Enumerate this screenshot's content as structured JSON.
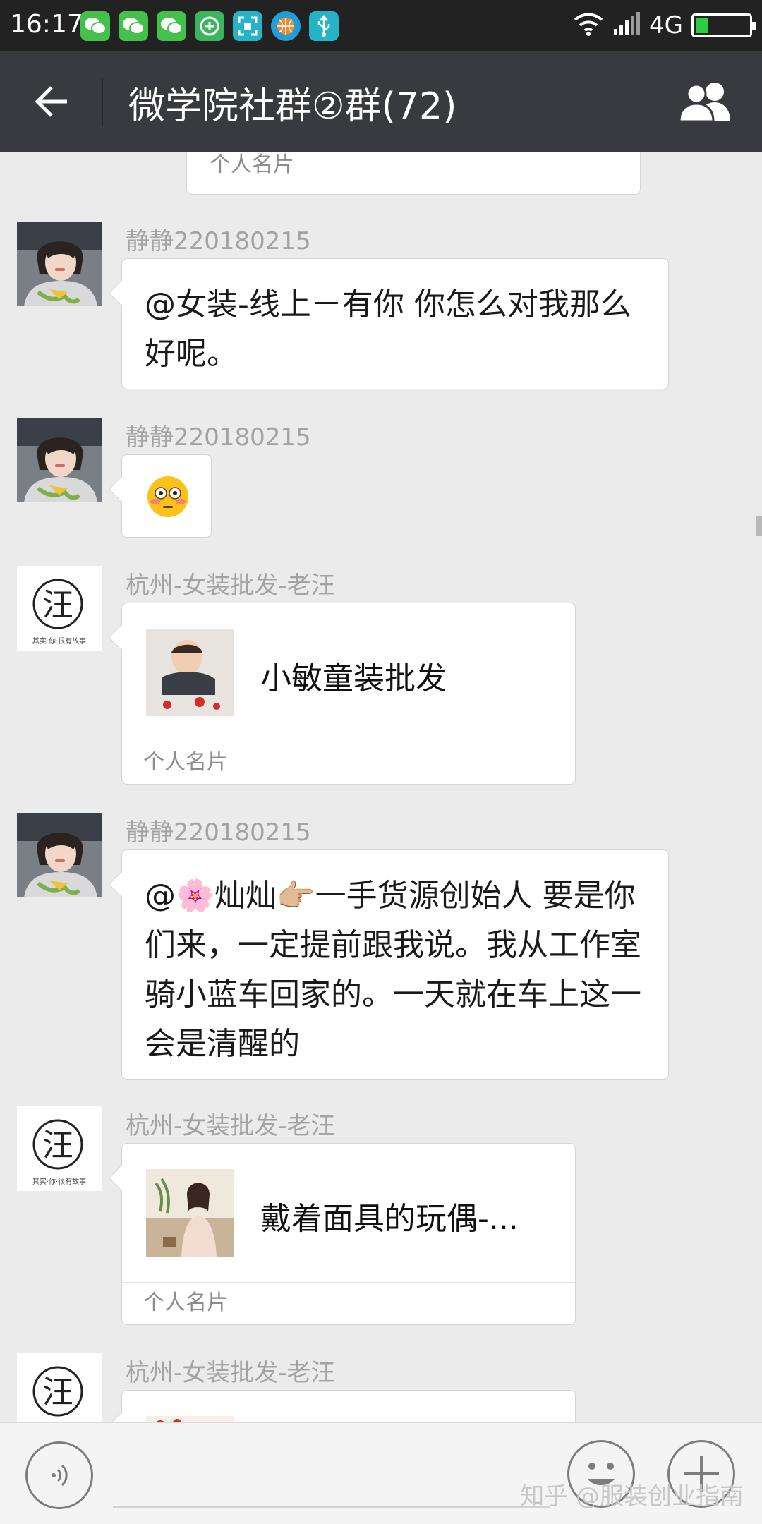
{
  "status_bar": {
    "time": "16:17",
    "network": "4G",
    "battery_level": 0.22,
    "notification_icons": [
      "wechat-icon",
      "wechat-icon",
      "wechat-icon",
      "plus-app-icon",
      "scan-icon",
      "basketball-icon",
      "usb-icon"
    ]
  },
  "header": {
    "title": "微学院社群②群(72)"
  },
  "chat": {
    "top_card_label": "个人名片",
    "messages": [
      {
        "sender": "静静220180215",
        "text": "@女装-线上－有你  你怎么对我那么好呢。"
      },
      {
        "sender": "静静220180215",
        "emoji": "flushed-face"
      },
      {
        "sender": "杭州-女装批发-老汪",
        "card_name": "小敏童装批发",
        "card_label": "个人名片"
      },
      {
        "sender": "静静220180215",
        "text": "@🌸灿灿👉🏼一手货源创始人  要是你们来，一定提前跟我说。我从工作室骑小蓝车回家的。一天就在车上这一会是清醒的"
      },
      {
        "sender": "杭州-女装批发-老汪",
        "card_name": "戴着面具的玩偶-...",
        "card_label": "个人名片"
      },
      {
        "sender": "杭州-女装批发-老汪"
      }
    ],
    "logo_avatar_char": "汪",
    "logo_avatar_caption": "其实·你·很有故事"
  },
  "input_bar": {
    "watermark": "知乎 @服装创业指南"
  },
  "colors": {
    "status_bar": "#222222",
    "title_bar": "#393a3f",
    "chat_bg": "#ebebeb",
    "bubble": "#ffffff",
    "sender_name": "#a3a3a3"
  }
}
